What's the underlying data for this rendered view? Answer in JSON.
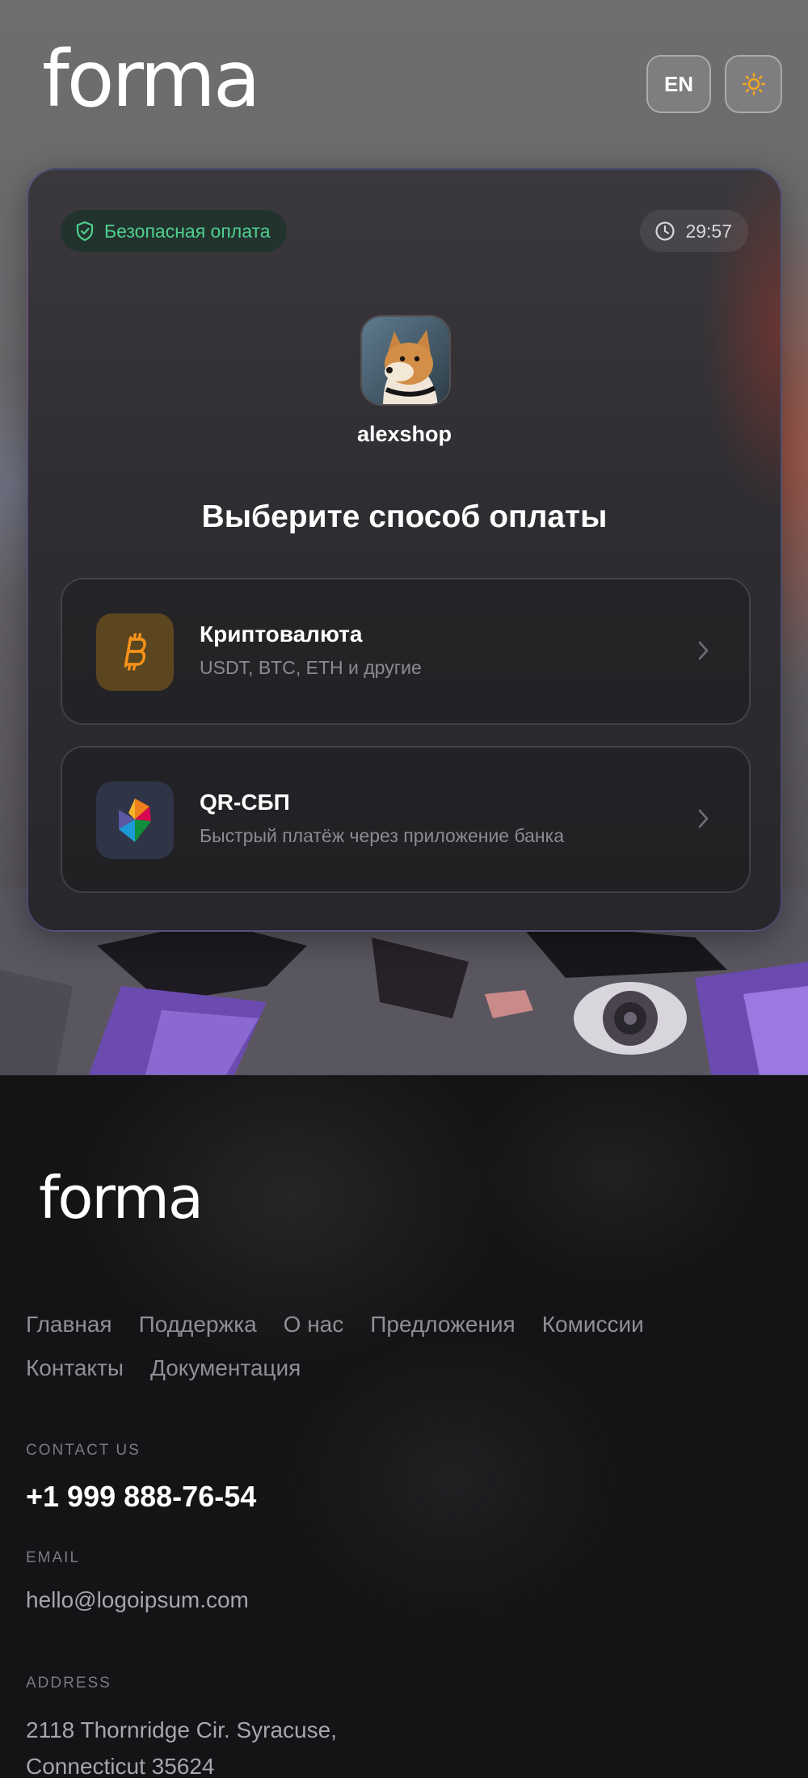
{
  "brand": {
    "logo_text": "forma"
  },
  "header": {
    "lang_label": "EN",
    "theme_icon": "sun-icon"
  },
  "card": {
    "secure_label": "Безопасная оплата",
    "timer": "29:57",
    "shop_name": "alexshop",
    "title": "Выберите способ оплаты",
    "options": [
      {
        "title": "Криптовалюта",
        "subtitle": "USDT, BTC, ETH и другие",
        "icon": "bitcoin-icon"
      },
      {
        "title": "QR-СБП",
        "subtitle": "Быстрый платёж через приложение банка",
        "icon": "sbp-icon"
      }
    ]
  },
  "footer": {
    "logo_text": "forma",
    "nav": [
      "Главная",
      "Поддержка",
      "О нас",
      "Предложения",
      "Комиссии",
      "Контакты",
      "Документация"
    ],
    "contact_label": "CONTACT US",
    "phone": "+1 999 888-76-54",
    "email_label": "EMAIL",
    "email": "hello@logoipsum.com",
    "address_label": "ADDRESS",
    "address_line1": "2118 Thornridge Cir. Syracuse,",
    "address_line2": "Connecticut 35624"
  },
  "colors": {
    "secure_green": "#4fcf8e",
    "bitcoin_orange": "#f7931a",
    "sun_orange": "#f5a623",
    "card_border": "#6e78be"
  }
}
